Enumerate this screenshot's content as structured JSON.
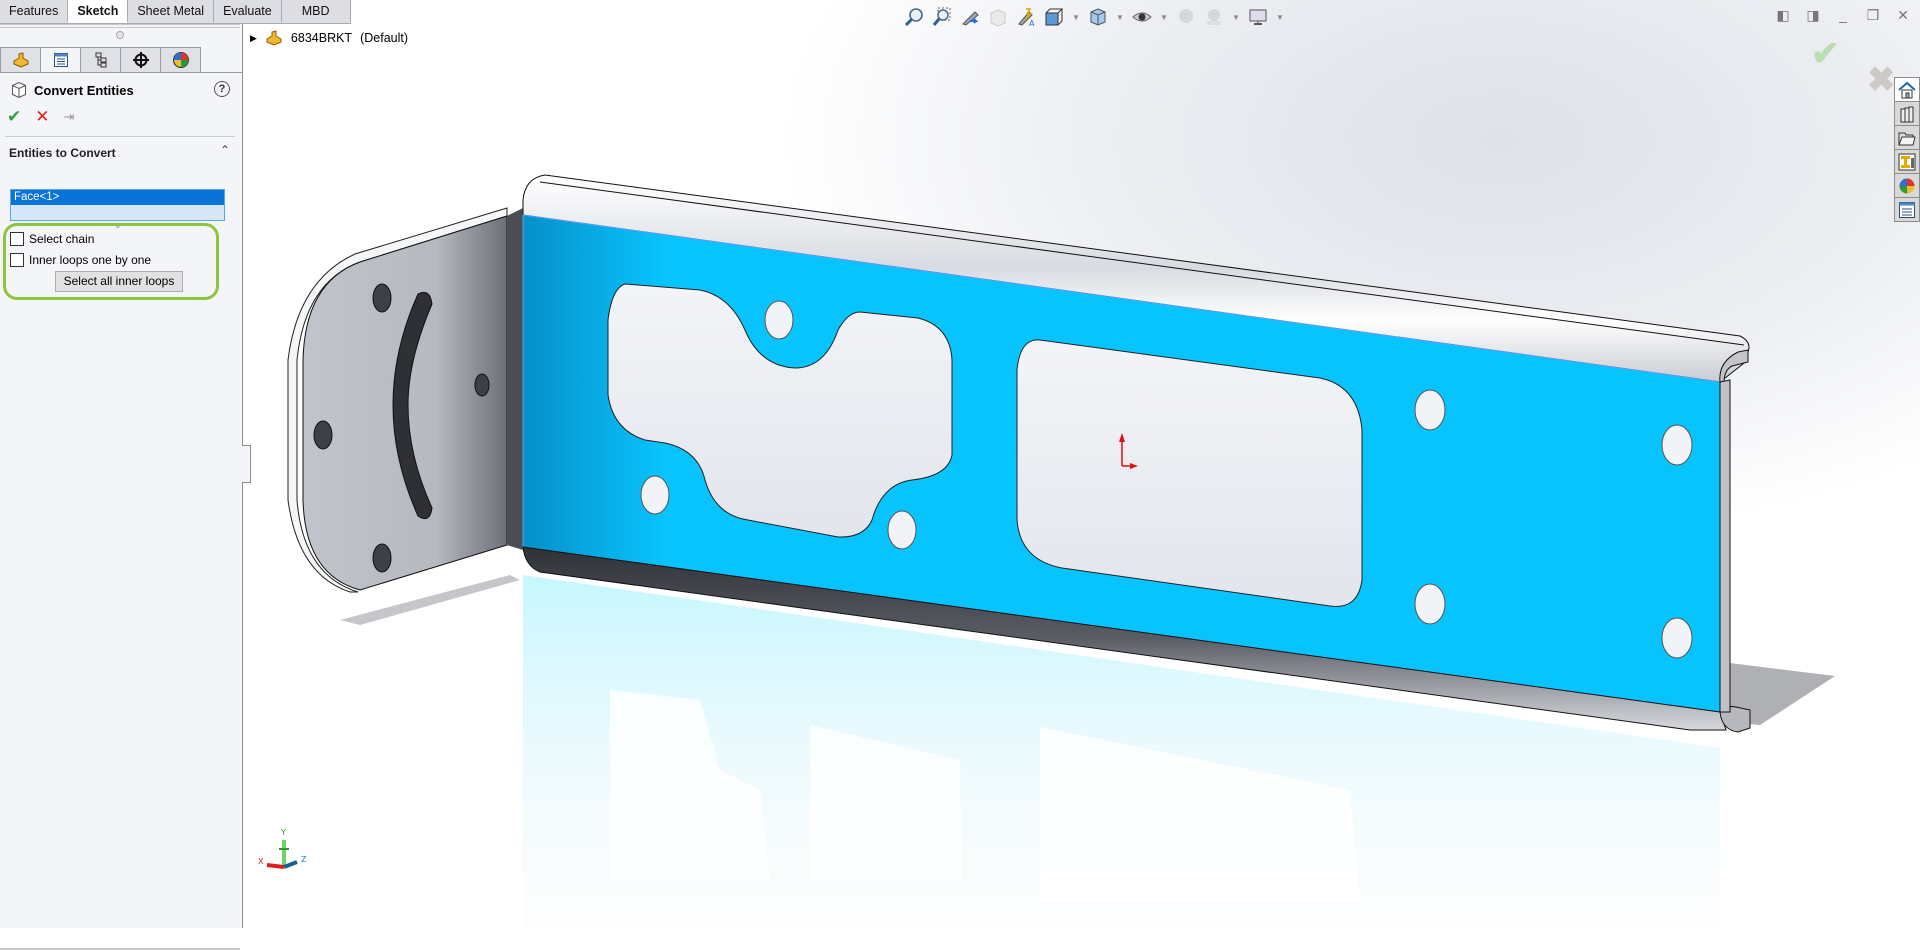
{
  "command_tabs": [
    {
      "label": "Features",
      "active": false
    },
    {
      "label": "Sketch",
      "active": true
    },
    {
      "label": "Sheet Metal",
      "active": false
    },
    {
      "label": "Evaluate",
      "active": false
    },
    {
      "label": "MBD",
      "active": false
    }
  ],
  "manager_tabs": [
    {
      "icon": "feature-manager-icon"
    },
    {
      "icon": "property-manager-icon",
      "active": true
    },
    {
      "icon": "configuration-manager-icon"
    },
    {
      "icon": "dimxpert-manager-icon"
    },
    {
      "icon": "display-manager-icon"
    }
  ],
  "property_manager": {
    "title": "Convert Entities",
    "help": "?",
    "ok_icon": "✔",
    "cancel_icon": "✕",
    "pin_icon": "⇥",
    "group_title": "Entities to Convert",
    "collapse_icon": "^",
    "selection_items": [
      "Face<1>"
    ],
    "select_chain_label": "Select chain",
    "select_chain_checked": false,
    "inner_loops_label": "Inner loops one by one",
    "inner_loops_checked": false,
    "select_all_button": "Select all inner loops"
  },
  "tree": {
    "part_name": "6834BRKT",
    "configuration": "(Default)"
  },
  "heads_up_toolbar": [
    "zoom-to-fit-icon",
    "zoom-to-area-icon",
    "previous-view-icon",
    "section-view-icon",
    "dynamic-annotation-views-icon",
    "view-orientation-icon",
    "display-style-icon",
    "hide-show-items-icon",
    "edit-appearance-icon",
    "apply-scene-icon",
    "view-settings-icon"
  ],
  "window_controls": [
    "◧",
    "◨",
    "_",
    "❐",
    "✕"
  ],
  "confirm_corner": {
    "ok": "✔",
    "cancel": "✖"
  },
  "task_pane": [
    "home-icon",
    "design-library-icon",
    "file-explorer-icon",
    "view-palette-icon",
    "appearances-icon",
    "custom-properties-icon"
  ],
  "triad": {
    "x": "X",
    "y": "Y",
    "z": "Z"
  },
  "colors": {
    "selected_face": "#08c4fe",
    "selection_highlight": "#0a74d6",
    "green_outline": "#8cc63f",
    "ok_green": "#2ea043",
    "cancel_red": "#e02020"
  }
}
